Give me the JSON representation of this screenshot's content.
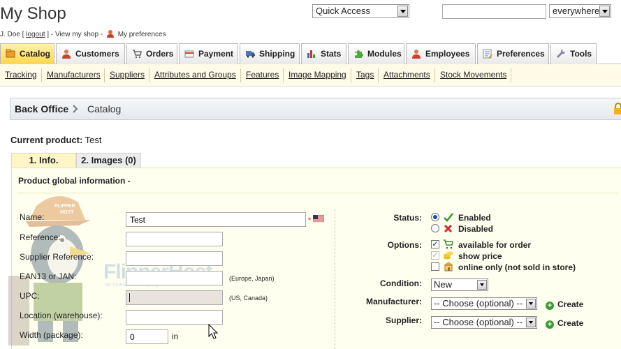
{
  "header": {
    "shop_title": "My Shop",
    "user_name": "J. Doe",
    "logout_label": "logout",
    "view_shop_label": "View my shop",
    "preferences_label": "My preferences",
    "quick_access": "Quick Access",
    "search_value": "",
    "search_scope": "everywhere"
  },
  "tabs": [
    {
      "label": "Catalog",
      "icon": "catalog-icon",
      "active": true
    },
    {
      "label": "Customers",
      "icon": "customers-icon"
    },
    {
      "label": "Orders",
      "icon": "orders-icon"
    },
    {
      "label": "Payment",
      "icon": "payment-icon"
    },
    {
      "label": "Shipping",
      "icon": "shipping-icon"
    },
    {
      "label": "Stats",
      "icon": "stats-icon"
    },
    {
      "label": "Modules",
      "icon": "modules-icon"
    },
    {
      "label": "Employees",
      "icon": "employees-icon"
    },
    {
      "label": "Preferences",
      "icon": "preferences-icon"
    },
    {
      "label": "Tools",
      "icon": "tools-icon"
    }
  ],
  "subnav": [
    "Tracking",
    "Manufacturers",
    "Suppliers",
    "Attributes and Groups",
    "Features",
    "Image Mapping",
    "Tags",
    "Attachments",
    "Stock Movements"
  ],
  "breadcrumb": {
    "root": "Back Office",
    "current": "Catalog"
  },
  "current_product": {
    "label": "Current product:",
    "name": "Test"
  },
  "product_tabs": {
    "info": "1. Info.",
    "images": "2. Images (0)"
  },
  "panel_title": "Product global information -",
  "watermark": {
    "brand": "FlipperHost",
    "tagline": "an investion company",
    "cap_text": "FLIPPER HOST"
  },
  "form_left": {
    "name_label": "Name:",
    "name_value": "Test",
    "reference_label": "Reference:",
    "supplier_reference_label": "Supplier Reference:",
    "ean_label": "EAN13 or JAN:",
    "ean_hint": "(Europe, Japan)",
    "upc_label": "UPC:",
    "upc_hint": "(US, Canada)",
    "location_label": "Location (warehouse):",
    "width_label": "Width (package):",
    "width_value": "0",
    "width_unit": "in",
    "required_mark": "*"
  },
  "form_right": {
    "status_label": "Status:",
    "enabled_label": "Enabled",
    "disabled_label": "Disabled",
    "options_label": "Options:",
    "available_label": "available for order",
    "show_price_label": "show price",
    "online_only_label": "online only (not sold in store)",
    "condition_label": "Condition:",
    "condition_value": "New",
    "manufacturer_label": "Manufacturer:",
    "manufacturer_value": "-- Choose (optional) --",
    "supplier_label": "Supplier:",
    "supplier_value": "-- Choose (optional) --",
    "create_label": "Create"
  },
  "colors": {
    "active_tab": "#ffd64a",
    "panel_bg": "#fffff0",
    "subnav_bg": "#fffbe8",
    "create_green": "#3c9a34",
    "enabled_green": "#2e9a2e",
    "disabled_red": "#d8262a"
  }
}
